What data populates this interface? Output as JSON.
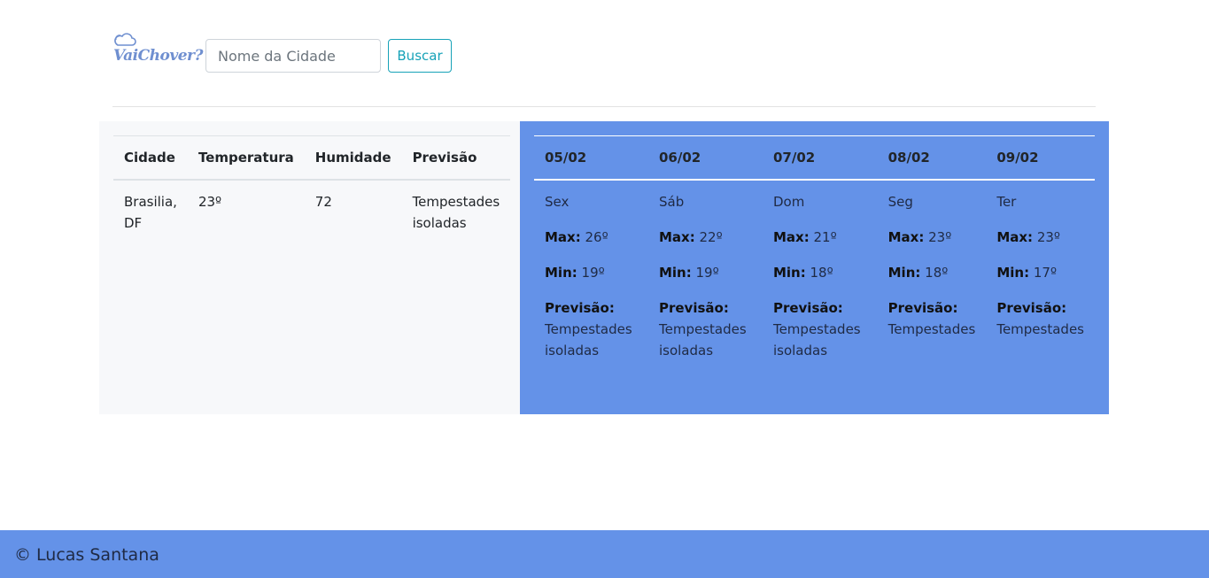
{
  "header": {
    "logo_text": "VaiChover?",
    "search_placeholder": "Nome da Cidade",
    "search_button": "Buscar"
  },
  "current": {
    "headers": [
      "Cidade",
      "Temperatura",
      "Humidade",
      "Previsão"
    ],
    "row": {
      "cidade_line1": "Brasilia,",
      "cidade_line2": "DF",
      "temperatura": "23º",
      "humidade": "72",
      "previsao_line1": "Tempestades",
      "previsao_line2": "isoladas"
    }
  },
  "forecast": {
    "labels": {
      "max": "Max:",
      "min": "Min:",
      "previsao": "Previsão:"
    },
    "days": [
      {
        "date": "05/02",
        "weekday": "Sex",
        "max": "26º",
        "min": "19º",
        "cond_line1": "Tempestades",
        "cond_line2": "isoladas"
      },
      {
        "date": "06/02",
        "weekday": "Sáb",
        "max": "22º",
        "min": "19º",
        "cond_line1": "Tempestades",
        "cond_line2": "isoladas"
      },
      {
        "date": "07/02",
        "weekday": "Dom",
        "max": "21º",
        "min": "18º",
        "cond_line1": "Tempestades",
        "cond_line2": "isoladas"
      },
      {
        "date": "08/02",
        "weekday": "Seg",
        "max": "23º",
        "min": "18º",
        "cond_line1": "Tempestades",
        "cond_line2": ""
      },
      {
        "date": "09/02",
        "weekday": "Ter",
        "max": "23º",
        "min": "17º",
        "cond_line1": "Tempestades",
        "cond_line2": ""
      }
    ]
  },
  "footer": {
    "text": "© Lucas Santana"
  },
  "colors": {
    "accent": "#6492e8",
    "button": "#17a2b8",
    "logo": "#6f8fd0"
  }
}
